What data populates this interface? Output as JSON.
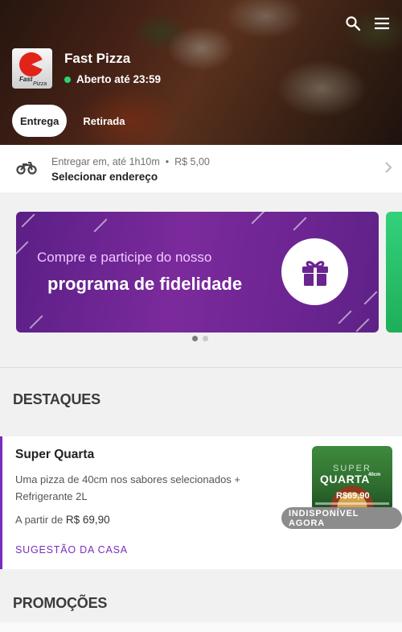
{
  "header": {
    "store_name": "Fast Pizza",
    "status": "Aberto até 23:59",
    "status_color": "#2dd36f",
    "logo_text_1": "Fast",
    "logo_text_2": "Pizza",
    "icons": [
      "search-icon",
      "menu-icon"
    ],
    "tabs": [
      {
        "label": "Entrega",
        "active": true
      },
      {
        "label": "Retirada",
        "active": false
      }
    ]
  },
  "delivery": {
    "icon": "motorcycle-icon",
    "eta": "Entregar em, até 1h10m",
    "fee": "R$ 5,00",
    "action": "Selecionar endereço"
  },
  "banner": {
    "line1": "Compre e participe do nosso",
    "line2": "programa de fidelidade",
    "icon": "gift-icon",
    "pages": 2,
    "current_page": 1,
    "accent": "#7b2a9c"
  },
  "sections": {
    "highlights": "DESTAQUES",
    "promotions": "PROMOÇÕES"
  },
  "highlight_item": {
    "title": "Super Quarta",
    "description": "Uma pizza de 40cm nos sabores selecionados + Refrigerante 2L",
    "price_prefix": "A partir de",
    "price": "R$ 69,90",
    "tag": "SUGESTÃO DA CASA",
    "badge": "INDISPONÍVEL AGORA",
    "accent": "#7b2cbf",
    "thumb": {
      "line1": "SUPER",
      "line2": "QUARTA",
      "size": "40cm",
      "price": "R$69,90"
    }
  }
}
